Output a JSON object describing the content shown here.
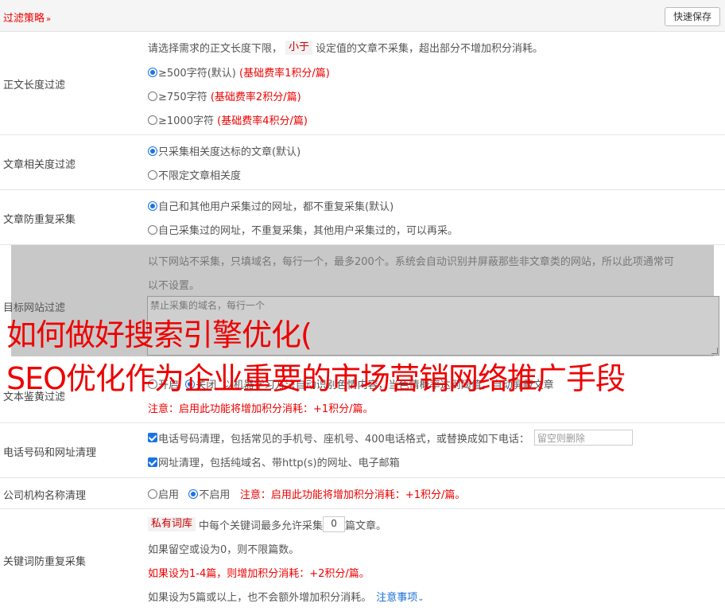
{
  "header": {
    "title": "过滤策略",
    "save_label": "快速保存"
  },
  "length_filter": {
    "label": "正文长度过滤",
    "desc_prefix": "请选择需求的正文长度下限，",
    "desc_tag": "小于",
    "desc_suffix": "设定值的文章不采集，超出部分不增加积分消耗。",
    "options": [
      {
        "text": "≥500字符(默认)",
        "note": "(基础费率1积分/篇)",
        "selected": true
      },
      {
        "text": "≥750字符",
        "note": "(基础费率2积分/篇)",
        "selected": false
      },
      {
        "text": "≥1000字符",
        "note": "(基础费率4积分/篇)",
        "selected": false
      }
    ]
  },
  "relevance": {
    "label": "文章相关度过滤",
    "options": [
      {
        "text": "只采集相关度达标的文章(默认)",
        "selected": true
      },
      {
        "text": "不限定文章相关度",
        "selected": false
      }
    ]
  },
  "dedupe": {
    "label": "文章防重复采集",
    "options": [
      {
        "text": "自己和其他用户采集过的网址，都不重复采集(默认)",
        "selected": true
      },
      {
        "text": "自己采集过的网址，不重复采集，其他用户采集过的，可以再采。",
        "selected": false
      }
    ]
  },
  "site_filter": {
    "label": "目标网站过滤",
    "desc_line1": "以下网站不采集，只填域名，每行一个，最多200个。系统会自动识别并屏蔽那些非文章类的网站，所以此项通常可",
    "desc_line2": "以不设置。",
    "placeholder": "禁止采集的域名，每行一个"
  },
  "text_check": {
    "label": "文本鉴黄过滤",
    "option_on": "开启",
    "option_off": "关闭",
    "desc": "以机器学习方法自动识别色情内容，当色情概率达到阈值，自动屏蔽文章",
    "note": "注意：启用此功能将增加积分消耗：+1积分/篇。"
  },
  "phone_clean": {
    "label": "电话号码和网址清理",
    "phone_text": "电话号码清理，包括常见的手机号、座机号、400电话格式，或替换成如下电话：",
    "phone_placeholder": "留空则删除",
    "url_text": "网址清理，包括纯域名、带http(s)的网址、电子邮箱"
  },
  "org_clean": {
    "label": "公司机构名称清理",
    "option_on": "启用",
    "option_off": "不启用",
    "note": "注意：启用此功能将增加积分消耗：+1积分/篇。"
  },
  "keyword_dedupe": {
    "label": "关键词防重复采集",
    "tag": "私有词库",
    "line1_a": "中每个关键词最多允许采集",
    "count": "0",
    "line1_b": "篇文章。",
    "line2": "如果留空或设为0，则不限篇数。",
    "line3": "如果设为1-4篇，则增加积分消耗：+2积分/篇。",
    "line4": "如果设为5篇或以上，也不会额外增加积分消耗。",
    "notice_link": "注意事项"
  },
  "banner": {
    "line1": "如何做好搜索引擎优化(",
    "line2": "SEO优化作为企业重要的市场营销网络推广手段"
  },
  "colors": {
    "accent": "#1a73e8",
    "warning": "#e00000",
    "overlay": "#c8c8c8"
  }
}
